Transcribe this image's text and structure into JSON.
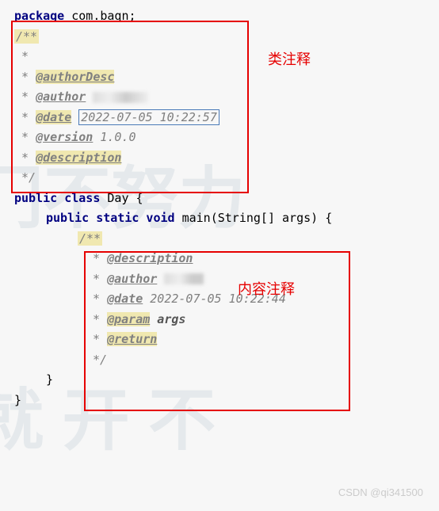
{
  "code": {
    "package_kw": "package",
    "package_name": " com.baqn;",
    "class_doc": {
      "open": "/**",
      "star": " *",
      "authorDesc": "@authorDesc",
      "author": "@author",
      "date": "@date",
      "date_value": "2022-07-05 10:22:57",
      "version": "@version",
      "version_value": " 1.0.0",
      "description": "@description",
      "close": " */"
    },
    "class_decl": {
      "public": "public",
      "class": " class ",
      "name": "Day {"
    },
    "method_decl": {
      "public": "public",
      "static": " static",
      "void": " void ",
      "sig": "main(String[] args) {"
    },
    "method_doc": {
      "open": "/**",
      "star": " *",
      "description": "@description",
      "author": "@author",
      "date": "@date",
      "date_value": " 2022-07-05 10:22:44",
      "param": "@param",
      "param_name": " args",
      "return": "@return",
      "close": " */"
    },
    "brace_close": "}"
  },
  "annotations": {
    "class_comment_label": "类注释",
    "method_comment_label": "内容注释"
  },
  "watermarks": {
    "wm1": "门不努力",
    "wm2": "就 开 不",
    "footer": "CSDN @qi341500"
  }
}
